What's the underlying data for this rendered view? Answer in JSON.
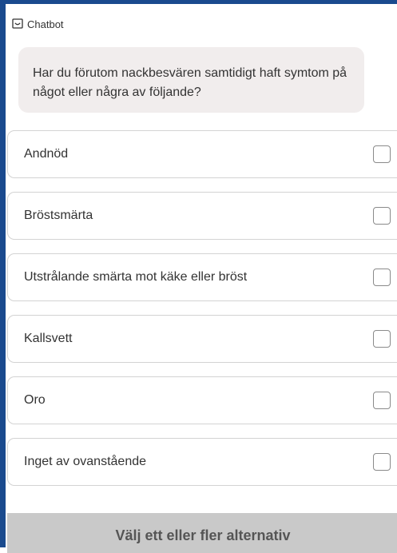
{
  "header": {
    "title": "Chatbot",
    "icon": "chat-icon"
  },
  "question": {
    "text": "Har du förutom nackbesvären samtidigt haft symtom på något eller några av följande?"
  },
  "options": [
    {
      "label": "Andnöd",
      "checked": false
    },
    {
      "label": "Bröstsmärta",
      "checked": false
    },
    {
      "label": "Utstrålande smärta mot käke eller bröst",
      "checked": false
    },
    {
      "label": "Kallsvett",
      "checked": false
    },
    {
      "label": "Oro",
      "checked": false
    },
    {
      "label": "Inget av ovanstående",
      "checked": false
    }
  ],
  "footer": {
    "button_label": "Välj ett eller fler alternativ"
  },
  "colors": {
    "frame_border": "#1a4a8e",
    "bubble_background": "#f1eded",
    "footer_background": "#c9c9c9"
  }
}
